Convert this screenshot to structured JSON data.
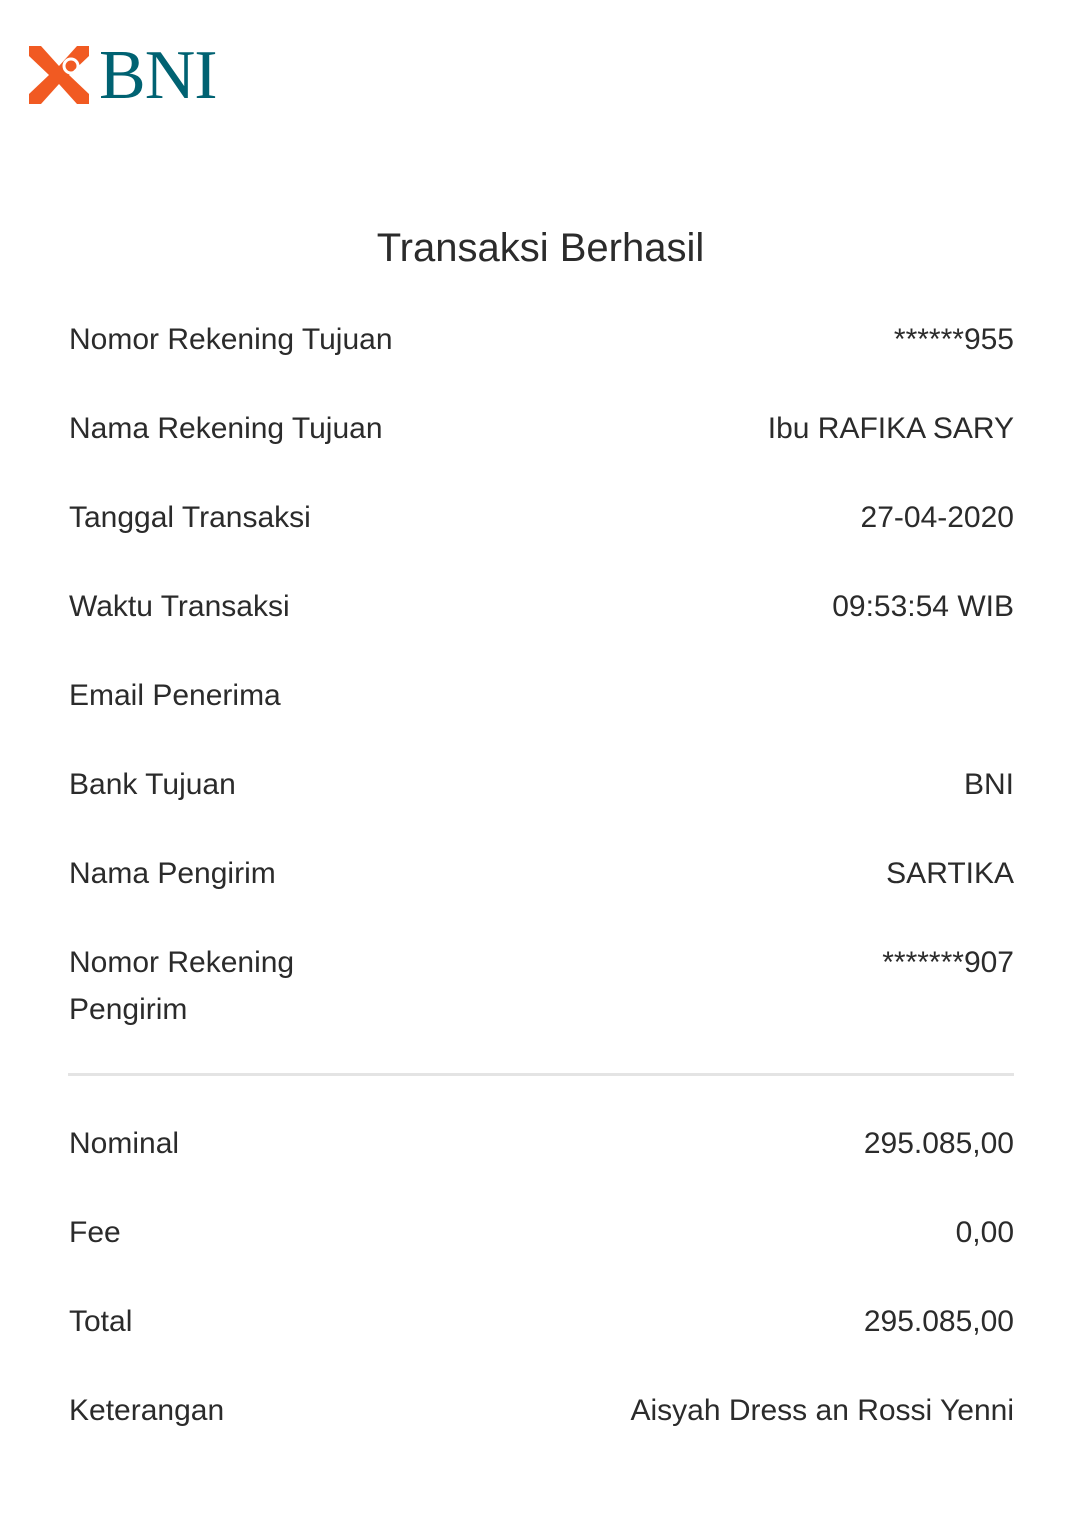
{
  "brand": {
    "logo_text": "BNI",
    "colors": {
      "mark": "#f15a22",
      "text": "#006272"
    }
  },
  "title": "Transaksi Berhasil",
  "details": [
    {
      "label": "Nomor Rekening Tujuan",
      "value": "******955"
    },
    {
      "label": "Nama Rekening Tujuan",
      "value": "Ibu RAFIKA SARY"
    },
    {
      "label": "Tanggal Transaksi",
      "value": "27-04-2020"
    },
    {
      "label": "Waktu Transaksi",
      "value": "09:53:54 WIB"
    },
    {
      "label": "Email Penerima",
      "value": ""
    },
    {
      "label": "Bank Tujuan",
      "value": "BNI"
    },
    {
      "label": "Nama Pengirim",
      "value": "SARTIKA"
    },
    {
      "label": "Nomor Rekening Pengirim",
      "value": "*******907"
    }
  ],
  "summary": [
    {
      "label": "Nominal",
      "value": "295.085,00"
    },
    {
      "label": "Fee",
      "value": "0,00"
    },
    {
      "label": "Total",
      "value": "295.085,00"
    },
    {
      "label": "Keterangan",
      "value": "Aisyah Dress an Rossi Yenni"
    }
  ]
}
